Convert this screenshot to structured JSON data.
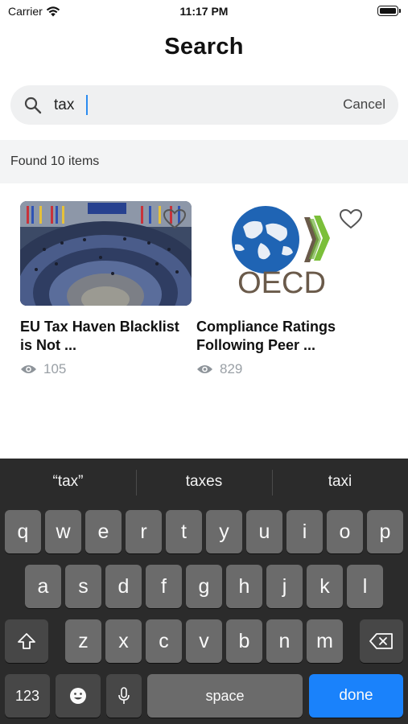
{
  "status_bar": {
    "carrier": "Carrier",
    "time": "11:17 PM"
  },
  "header": {
    "title": "Search"
  },
  "search": {
    "value": "tax",
    "cancel_label": "Cancel"
  },
  "results": {
    "summary": "Found 10 items"
  },
  "cards": [
    {
      "title": "EU Tax Haven Blacklist is Not ...",
      "views": "105",
      "image": "parliament-chamber-photo"
    },
    {
      "title": "Compliance Ratings Following Peer ...",
      "views": "829",
      "image": "oecd-logo",
      "logo_text": "OECD"
    }
  ],
  "keyboard": {
    "suggestions": [
      "“tax”",
      "taxes",
      "taxi"
    ],
    "row1": [
      "q",
      "w",
      "e",
      "r",
      "t",
      "y",
      "u",
      "i",
      "o",
      "p"
    ],
    "row2": [
      "a",
      "s",
      "d",
      "f",
      "g",
      "h",
      "j",
      "k",
      "l"
    ],
    "row3": [
      "z",
      "x",
      "c",
      "v",
      "b",
      "n",
      "m"
    ],
    "numbers_label": "123",
    "space_label": "space",
    "done_label": "done"
  },
  "colors": {
    "accent": "#1a82fb",
    "keyboard_bg": "#2b2b2b",
    "key_bg": "#6b6b6b",
    "search_bg": "#eff0f1"
  }
}
